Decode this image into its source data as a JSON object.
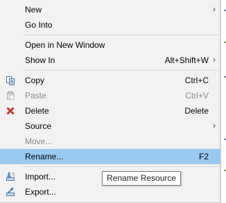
{
  "menu": {
    "items": [
      {
        "label": "New",
        "accel": "",
        "submenu": true,
        "icon": "",
        "disabled": false
      },
      {
        "label": "Go Into",
        "accel": "",
        "submenu": false,
        "icon": "",
        "disabled": false
      },
      {
        "label": "Open in New Window",
        "accel": "",
        "submenu": false,
        "icon": "",
        "disabled": false
      },
      {
        "label": "Show In",
        "accel": "Alt+Shift+W",
        "submenu": true,
        "icon": "",
        "disabled": false
      },
      {
        "label": "Copy",
        "accel": "Ctrl+C",
        "submenu": false,
        "icon": "copy-icon",
        "disabled": false
      },
      {
        "label": "Paste",
        "accel": "Ctrl+V",
        "submenu": false,
        "icon": "paste-icon",
        "disabled": true
      },
      {
        "label": "Delete",
        "accel": "Delete",
        "submenu": false,
        "icon": "delete-icon",
        "disabled": false
      },
      {
        "label": "Source",
        "accel": "",
        "submenu": true,
        "icon": "",
        "disabled": false
      },
      {
        "label": "Move...",
        "accel": "",
        "submenu": false,
        "icon": "",
        "disabled": true
      },
      {
        "label": "Rename...",
        "accel": "F2",
        "submenu": false,
        "icon": "",
        "disabled": false,
        "selected": true
      },
      {
        "label": "Import...",
        "accel": "",
        "submenu": false,
        "icon": "import-icon",
        "disabled": false
      },
      {
        "label": "Export...",
        "accel": "",
        "submenu": false,
        "icon": "export-icon",
        "disabled": false
      }
    ]
  },
  "tooltip": {
    "text": "Rename Resource"
  },
  "colors": {
    "selection": "#99c9ef",
    "menu_bg": "#f2f2f2",
    "disabled_text": "#8a8a8a",
    "delete_icon": "#d9342b"
  }
}
